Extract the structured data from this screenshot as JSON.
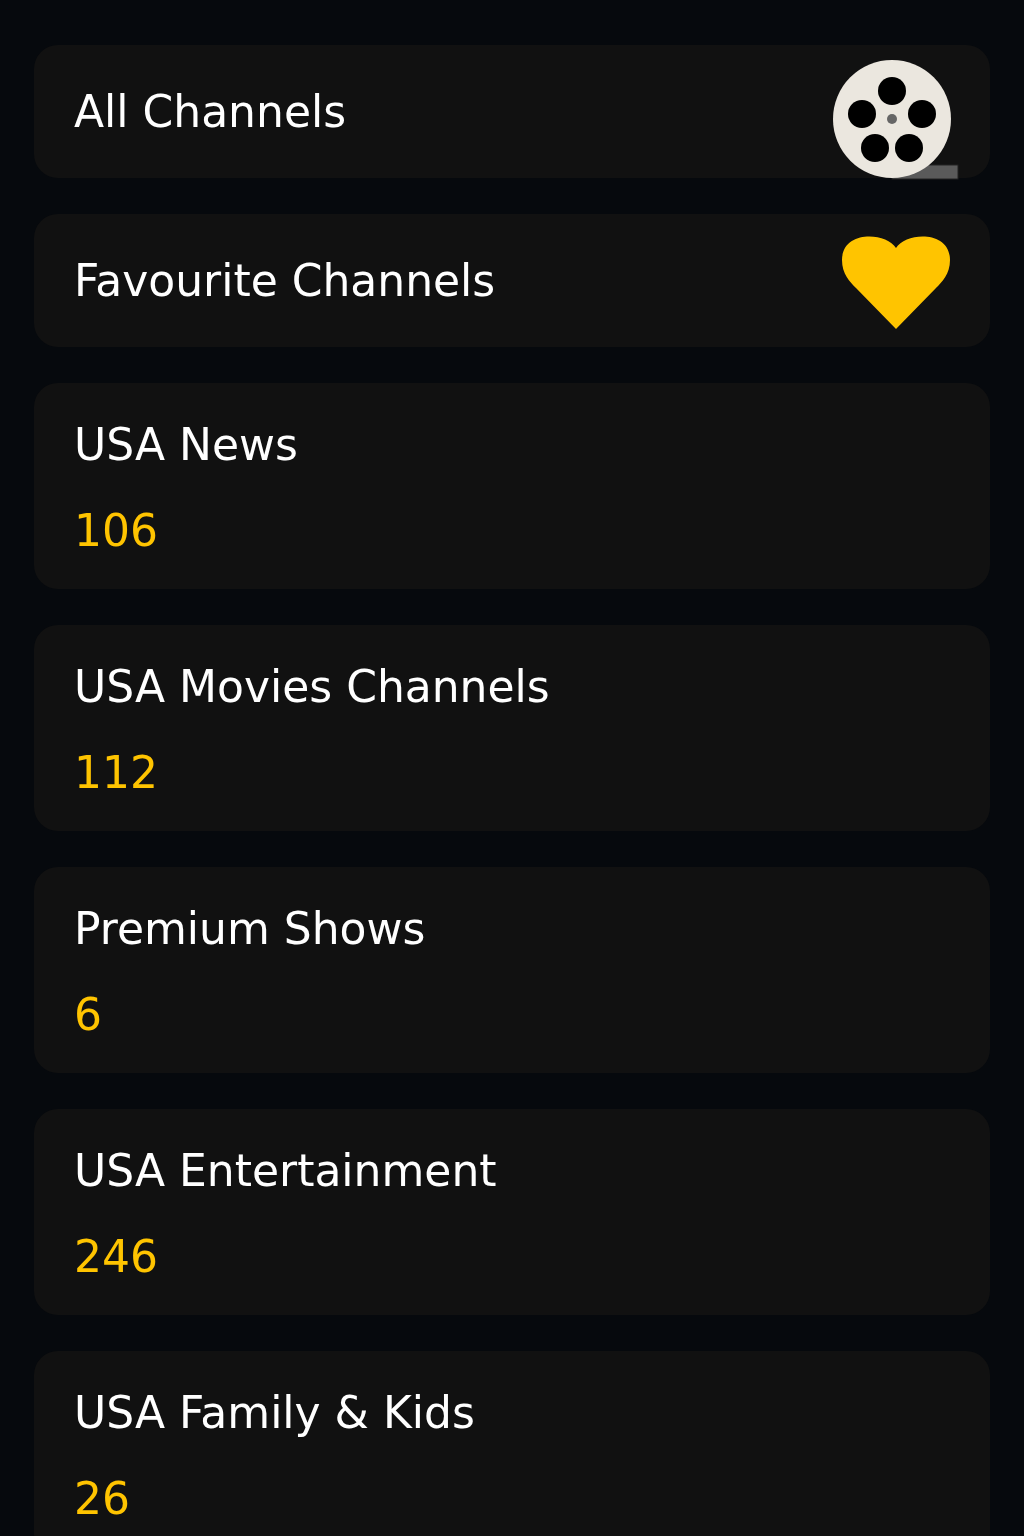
{
  "items": [
    {
      "kind": "all",
      "label": "All Channels"
    },
    {
      "kind": "favourites",
      "label": "Favourite Channels"
    },
    {
      "kind": "category",
      "label": "USA News",
      "count": "106"
    },
    {
      "kind": "category",
      "label": "USA Movies Channels",
      "count": "112"
    },
    {
      "kind": "category",
      "label": "Premium Shows",
      "count": "6"
    },
    {
      "kind": "category",
      "label": "USA Entertainment",
      "count": "246"
    },
    {
      "kind": "category",
      "label": "USA Family & Kids",
      "count": "26"
    }
  ]
}
